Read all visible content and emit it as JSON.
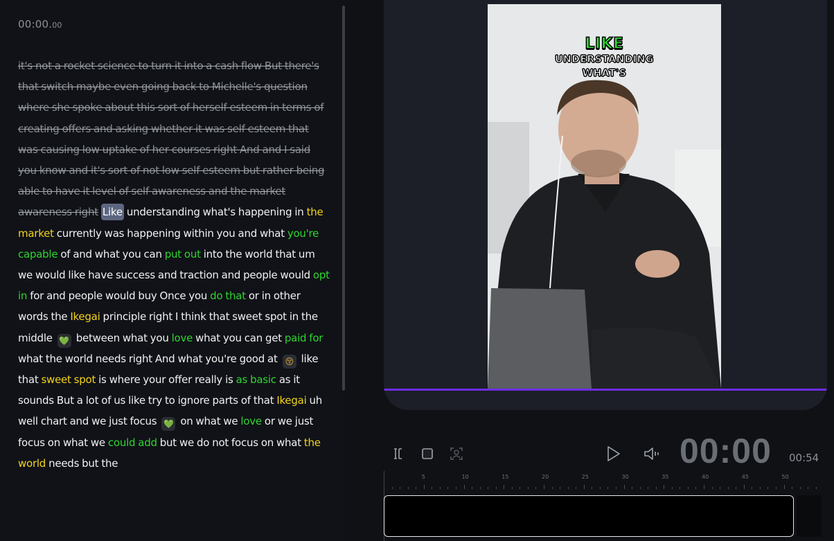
{
  "timecode": {
    "main": "00:00.",
    "ms": "00"
  },
  "transcript": {
    "struck": "it's not a rocket science to turn it into a cash flow But there's that switch maybe even going back to Michelle's question where she spoke about this sort of herself esteem in terms of creating offers and asking whether it was self esteem that was causing low uptake of her courses right And and I said you know and it's sort of not low self esteem but rather being able to have it level of self awareness and the market awareness right",
    "current_word": "Like",
    "segments": [
      {
        "t": " understanding what's happening in ",
        "c": ""
      },
      {
        "t": "the market",
        "c": "y"
      },
      {
        "t": " currently was happening within you and what ",
        "c": ""
      },
      {
        "t": "you're capable",
        "c": "g"
      },
      {
        "t": " of and what you can ",
        "c": ""
      },
      {
        "t": "put out",
        "c": "g"
      },
      {
        "t": " into the world that um we would like have success and traction and people would ",
        "c": ""
      },
      {
        "t": "opt in",
        "c": "g"
      },
      {
        "t": " for and people would buy Once you ",
        "c": ""
      },
      {
        "t": "do that",
        "c": "g"
      },
      {
        "t": " or in other words the ",
        "c": ""
      },
      {
        "t": "Ikegai",
        "c": "y"
      },
      {
        "t": " principle right I think that sweet spot in the middle ",
        "c": ""
      },
      {
        "t": "💚",
        "c": "heart"
      },
      {
        "t": " between what you ",
        "c": ""
      },
      {
        "t": "love",
        "c": "g"
      },
      {
        "t": " what you can get ",
        "c": ""
      },
      {
        "t": "paid for",
        "c": "g"
      },
      {
        "t": " what the world needs right And what you're good at ",
        "c": ""
      },
      {
        "t": "😚",
        "c": "face"
      },
      {
        "t": " like that ",
        "c": ""
      },
      {
        "t": "sweet spot",
        "c": "y"
      },
      {
        "t": " is where your offer really is ",
        "c": ""
      },
      {
        "t": "as basic",
        "c": "g"
      },
      {
        "t": " as it sounds But a lot of us like try to ignore parts of that ",
        "c": ""
      },
      {
        "t": "Ikegai",
        "c": "y"
      },
      {
        "t": " uh well chart and we just focus ",
        "c": ""
      },
      {
        "t": "💚",
        "c": "heart"
      },
      {
        "t": " on what we ",
        "c": ""
      },
      {
        "t": "love",
        "c": "g"
      },
      {
        "t": " or we just focus on what we ",
        "c": ""
      },
      {
        "t": "could add",
        "c": "g"
      },
      {
        "t": " but we do not focus on what ",
        "c": ""
      },
      {
        "t": "the world",
        "c": "y"
      },
      {
        "t": " needs but the",
        "c": ""
      }
    ]
  },
  "video": {
    "caption_line1": "LIKE",
    "caption_line2": "UNDERSTANDING",
    "caption_line3": "WHAT'S"
  },
  "controls": {
    "trim_icon": "trim-icon",
    "stop_icon": "stop-icon",
    "face_icon": "face-track-icon",
    "play_icon": "play-icon",
    "volume_icon": "volume-icon",
    "timer_big": "00:00",
    "timer_total": "00:54"
  },
  "timeline": {
    "tick_labels": [
      "5",
      "10",
      "15",
      "20",
      "25",
      "30",
      "35",
      "40",
      "45",
      "50"
    ]
  },
  "colors": {
    "highlight_yellow": "#f3d31c",
    "highlight_green": "#2ed52e",
    "playhead_purple": "#6d2cf0"
  }
}
